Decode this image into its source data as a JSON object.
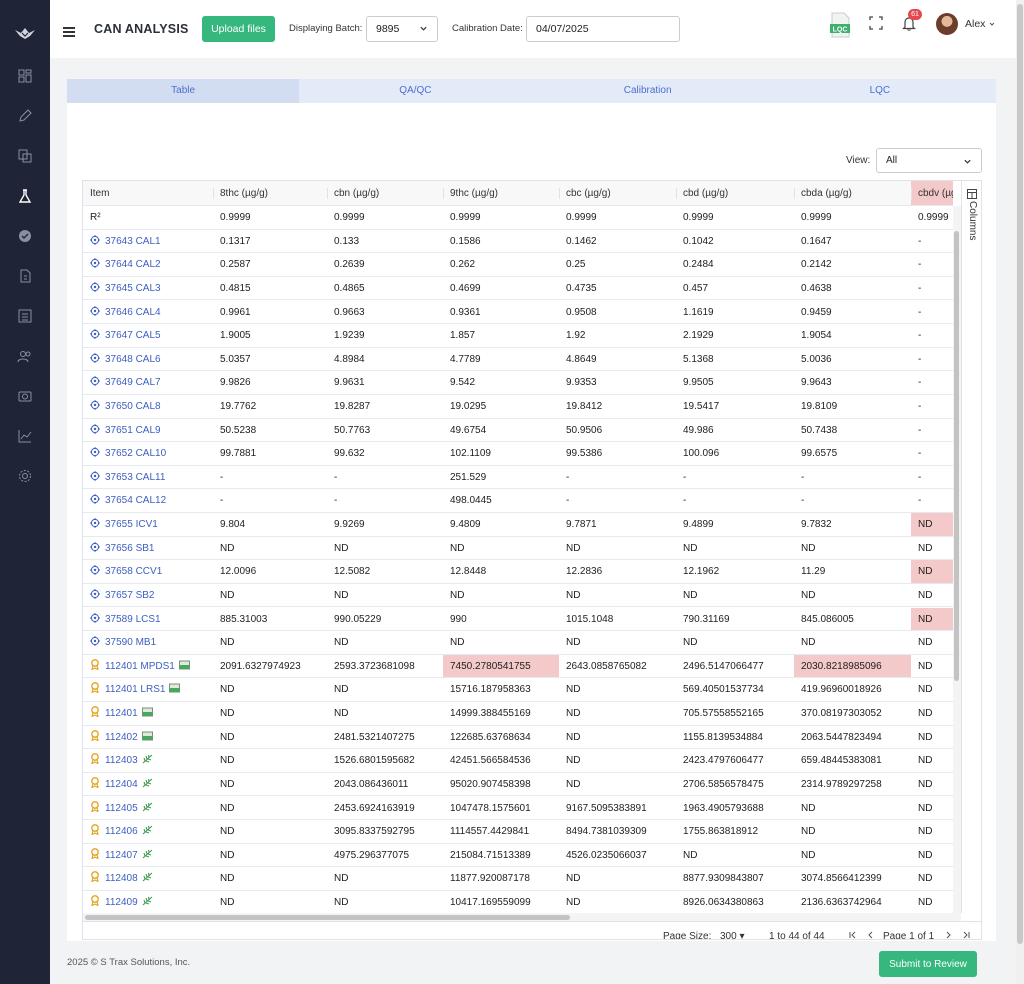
{
  "header": {
    "app_title": "CAN ANALYSIS",
    "upload_label": "Upload files",
    "batch_label": "Displaying Batch:",
    "batch_value": "9895",
    "calibration_label": "Calibration Date:",
    "calibration_value": "04/07/2025",
    "notification_count": "61",
    "user_name": "Alex"
  },
  "tabs": [
    "Table",
    "QA/QC",
    "Calibration",
    "LQC"
  ],
  "view": {
    "label": "View:",
    "value": "All"
  },
  "columns": [
    "Item",
    "8thc (µg/g)",
    "cbn (µg/g)",
    "9thc (µg/g)",
    "cbc (µg/g)",
    "cbd (µg/g)",
    "cbda (µg/g)",
    "cbdv (µg/g)"
  ],
  "columns_label": "Columns",
  "rows": [
    {
      "item": "R²",
      "icon": "none",
      "mini": "none",
      "values": [
        "0.9999",
        "0.9999",
        "0.9999",
        "0.9999",
        "0.9999",
        "0.9999",
        "0.9999"
      ],
      "hl": []
    },
    {
      "item": "37643 CAL1",
      "icon": "target",
      "mini": "none",
      "values": [
        "0.1317",
        "0.133",
        "0.1586",
        "0.1462",
        "0.1042",
        "0.1647",
        "-"
      ],
      "hl": []
    },
    {
      "item": "37644 CAL2",
      "icon": "target",
      "mini": "none",
      "values": [
        "0.2587",
        "0.2639",
        "0.262",
        "0.25",
        "0.2484",
        "0.2142",
        "-"
      ],
      "hl": []
    },
    {
      "item": "37645 CAL3",
      "icon": "target",
      "mini": "none",
      "values": [
        "0.4815",
        "0.4865",
        "0.4699",
        "0.4735",
        "0.457",
        "0.4638",
        "-"
      ],
      "hl": []
    },
    {
      "item": "37646 CAL4",
      "icon": "target",
      "mini": "none",
      "values": [
        "0.9961",
        "0.9663",
        "0.9361",
        "0.9508",
        "1.1619",
        "0.9459",
        "-"
      ],
      "hl": []
    },
    {
      "item": "37647 CAL5",
      "icon": "target",
      "mini": "none",
      "values": [
        "1.9005",
        "1.9239",
        "1.857",
        "1.92",
        "2.1929",
        "1.9054",
        "-"
      ],
      "hl": []
    },
    {
      "item": "37648 CAL6",
      "icon": "target",
      "mini": "none",
      "values": [
        "5.0357",
        "4.8984",
        "4.7789",
        "4.8649",
        "5.1368",
        "5.0036",
        "-"
      ],
      "hl": []
    },
    {
      "item": "37649 CAL7",
      "icon": "target",
      "mini": "none",
      "values": [
        "9.9826",
        "9.9631",
        "9.542",
        "9.9353",
        "9.9505",
        "9.9643",
        "-"
      ],
      "hl": []
    },
    {
      "item": "37650 CAL8",
      "icon": "target",
      "mini": "none",
      "values": [
        "19.7762",
        "19.8287",
        "19.0295",
        "19.8412",
        "19.5417",
        "19.8109",
        "-"
      ],
      "hl": []
    },
    {
      "item": "37651 CAL9",
      "icon": "target",
      "mini": "none",
      "values": [
        "50.5238",
        "50.7763",
        "49.6754",
        "50.9506",
        "49.986",
        "50.7438",
        "-"
      ],
      "hl": []
    },
    {
      "item": "37652 CAL10",
      "icon": "target",
      "mini": "none",
      "values": [
        "99.7881",
        "99.632",
        "102.1109",
        "99.5386",
        "100.096",
        "99.6575",
        "-"
      ],
      "hl": []
    },
    {
      "item": "37653 CAL11",
      "icon": "target",
      "mini": "none",
      "values": [
        "-",
        "-",
        "251.529",
        "-",
        "-",
        "-",
        "-"
      ],
      "hl": []
    },
    {
      "item": "37654 CAL12",
      "icon": "target",
      "mini": "none",
      "values": [
        "-",
        "-",
        "498.0445",
        "-",
        "-",
        "-",
        "-"
      ],
      "hl": []
    },
    {
      "item": "37655 ICV1",
      "icon": "target",
      "mini": "none",
      "values": [
        "9.804",
        "9.9269",
        "9.4809",
        "9.7871",
        "9.4899",
        "9.7832",
        "ND"
      ],
      "hl": [
        6
      ]
    },
    {
      "item": "37656 SB1",
      "icon": "target",
      "mini": "none",
      "values": [
        "ND",
        "ND",
        "ND",
        "ND",
        "ND",
        "ND",
        "ND"
      ],
      "hl": []
    },
    {
      "item": "37658 CCV1",
      "icon": "target",
      "mini": "none",
      "values": [
        "12.0096",
        "12.5082",
        "12.8448",
        "12.2836",
        "12.1962",
        "11.29",
        "ND"
      ],
      "hl": [
        6
      ]
    },
    {
      "item": "37657 SB2",
      "icon": "target",
      "mini": "none",
      "values": [
        "ND",
        "ND",
        "ND",
        "ND",
        "ND",
        "ND",
        "ND"
      ],
      "hl": []
    },
    {
      "item": "37589 LCS1",
      "icon": "target",
      "mini": "none",
      "values": [
        "885.31003",
        "990.05229",
        "990",
        "1015.1048",
        "790.31169",
        "845.086005",
        "ND"
      ],
      "hl": [
        6
      ]
    },
    {
      "item": "37590 MB1",
      "icon": "target",
      "mini": "none",
      "values": [
        "ND",
        "ND",
        "ND",
        "ND",
        "ND",
        "ND",
        "ND"
      ],
      "hl": []
    },
    {
      "item": "112401 MPDS1",
      "icon": "award",
      "mini": "product",
      "values": [
        "2091.6327974923",
        "2593.3723681098",
        "7450.2780541755",
        "2643.0858765082",
        "2496.5147066477",
        "2030.8218985096",
        "ND"
      ],
      "hl": [
        2,
        5
      ]
    },
    {
      "item": "112401 LRS1",
      "icon": "award",
      "mini": "product",
      "values": [
        "ND",
        "ND",
        "15716.187958363",
        "ND",
        "569.40501537734",
        "419.96960018926",
        "ND"
      ],
      "hl": []
    },
    {
      "item": "112401",
      "icon": "award",
      "mini": "product",
      "values": [
        "ND",
        "ND",
        "14999.388455169",
        "ND",
        "705.57558552165",
        "370.08197303052",
        "ND"
      ],
      "hl": []
    },
    {
      "item": "112402",
      "icon": "award",
      "mini": "product",
      "values": [
        "ND",
        "2481.5321407275",
        "122685.63768634",
        "ND",
        "1155.8139534884",
        "2063.5447823494",
        "ND"
      ],
      "hl": []
    },
    {
      "item": "112403",
      "icon": "award",
      "mini": "leaf",
      "values": [
        "ND",
        "1526.6801595682",
        "42451.566584536",
        "ND",
        "2423.4797606477",
        "659.48445383081",
        "ND"
      ],
      "hl": []
    },
    {
      "item": "112404",
      "icon": "award",
      "mini": "leaf",
      "values": [
        "ND",
        "2043.086436011",
        "95020.907458398",
        "ND",
        "2706.5856578475",
        "2314.9789297258",
        "ND"
      ],
      "hl": []
    },
    {
      "item": "112405",
      "icon": "award",
      "mini": "leaf",
      "values": [
        "ND",
        "2453.6924163919",
        "1047478.1575601",
        "9167.5095383891",
        "1963.4905793688",
        "ND",
        "ND"
      ],
      "hl": []
    },
    {
      "item": "112406",
      "icon": "award",
      "mini": "leaf",
      "values": [
        "ND",
        "3095.8337592795",
        "1114557.4429841",
        "8494.7381039309",
        "1755.863818912",
        "ND",
        "ND"
      ],
      "hl": []
    },
    {
      "item": "112407",
      "icon": "award",
      "mini": "leaf",
      "values": [
        "ND",
        "4975.296377075",
        "215084.71513389",
        "4526.0235066037",
        "ND",
        "ND",
        "ND"
      ],
      "hl": []
    },
    {
      "item": "112408",
      "icon": "award",
      "mini": "leaf",
      "values": [
        "ND",
        "ND",
        "11877.920087178",
        "ND",
        "8877.9309843807",
        "3074.8566412399",
        "ND"
      ],
      "hl": []
    },
    {
      "item": "112409",
      "icon": "award",
      "mini": "leaf",
      "values": [
        "ND",
        "ND",
        "10417.169559099",
        "ND",
        "8926.0634380863",
        "2136.6363742964",
        "ND"
      ],
      "hl": []
    }
  ],
  "pager": {
    "page_size_label": "Page Size:",
    "page_size": "300",
    "range": "1 to 44 of 44",
    "page": "Page 1 of 1"
  },
  "footer": {
    "copyright": "2025 © S Trax Solutions, Inc.",
    "submit_label": "Submit to Review"
  },
  "colors": {
    "sidebar": "#1f2436",
    "accent_green": "#35b77e",
    "link_blue": "#3b5fc4",
    "highlight_red": "#f3c9c9",
    "tab_bg": "#e4ebf8"
  }
}
